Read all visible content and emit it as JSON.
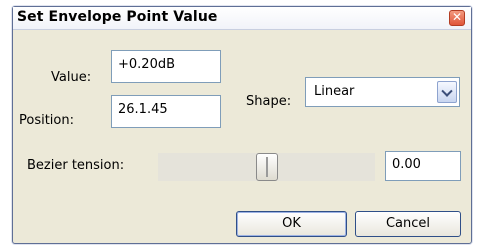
{
  "window": {
    "title": "Set Envelope Point Value",
    "close_symbol": "✕"
  },
  "form": {
    "value_label": "Value:",
    "value_field": "+0.20dB",
    "position_label": "Position:",
    "position_field": "26.1.45",
    "shape_label": "Shape:",
    "shape_selected": "Linear",
    "bezier_label": "Bezier tension:",
    "bezier_value": "0.00"
  },
  "buttons": {
    "ok": "OK",
    "cancel": "Cancel"
  }
}
